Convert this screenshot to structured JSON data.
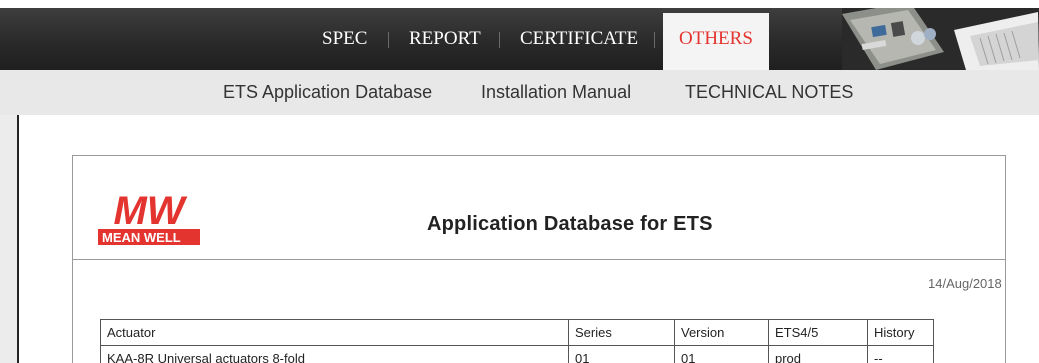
{
  "nav": {
    "tabs": [
      "SPEC",
      "REPORT",
      "CERTIFICATE",
      "OTHERS"
    ],
    "active_tab": "OTHERS",
    "active_color": "#e3342f"
  },
  "subnav": {
    "links": [
      "ETS Application Database",
      "Installation Manual",
      "TECHNICAL NOTES"
    ]
  },
  "document": {
    "logo": {
      "mark": "MW",
      "name": "MEAN WELL",
      "color": "#e3342f"
    },
    "title": "Application Database for ETS",
    "date": "14/Aug/2018",
    "table": {
      "headers": [
        "Actuator",
        "Series",
        "Version",
        "ETS4/5",
        "History"
      ],
      "rows": [
        [
          "KAA-8R Universal actuators 8-fold",
          "01",
          "01",
          "prod",
          "--"
        ]
      ]
    }
  }
}
